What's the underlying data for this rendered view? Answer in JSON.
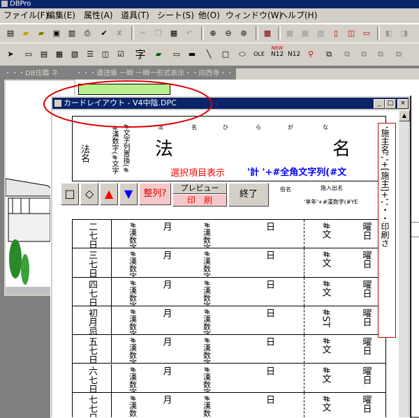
{
  "app": {
    "title": "DBPro"
  },
  "menu": [
    "ファイル(F)",
    "編集(E)",
    "属性(A)",
    "道具(T)",
    "シート(S)",
    "他(O)",
    "ウィンドウ(W)",
    "ヘルプ(H)"
  ],
  "bg_windows": {
    "db_title": "・・・DB住職 ネ",
    "form_title": "・・・運送帳 一瞬 一瞬一形式表示・・向西寺・・"
  },
  "card_window": {
    "title": "カードレイアウト - V4中陰.DPC",
    "min": "_",
    "max": "□",
    "close": "×"
  },
  "header": {
    "hint1": "#文字列置換(#",
    "hint2": "#漢数字(#文字",
    "label_hou": "法名",
    "furigana1": "法",
    "furigana2": "名",
    "furigana3": "ひ",
    "furigana4": "ら",
    "furigana5": "が",
    "furigana6": "な",
    "big1": "法",
    "big2": "名",
    "selection_red": "選択項目表示",
    "formula_blue": "'計  '+#全角文字列(#文",
    "sub_label": "俗名",
    "sub_label2": "施入出名",
    "sub_formula": "'享年'+#漢数字(#YE"
  },
  "buttons": {
    "square": "□",
    "diamond": "◇",
    "up": "▲",
    "down": "▼",
    "align": "整列?",
    "preview": "プレビュー",
    "print": "印　刷",
    "finish": "終了"
  },
  "side_panel": {
    "text": "'施主名','+[施主]+','・・印刷さ"
  },
  "rows": [
    {
      "day": "二七日",
      "cell2": "#漢数字(#日",
      "cell3": "月",
      "cell4": "#漢数字(#",
      "cell5": "日",
      "cell6": "#文",
      "cell7": "曜日"
    },
    {
      "day": "三七日",
      "cell2": "#漢数字(#日",
      "cell3": "月",
      "cell4": "#漢数字(#",
      "cell5": "日",
      "cell6": "#文",
      "cell7": "曜日"
    },
    {
      "day": "四七日",
      "cell2": "#漢数字(#日",
      "cell3": "月",
      "cell4": "#漢数字(#",
      "cell5": "日",
      "cell6": "#文",
      "cell7": "曜日"
    },
    {
      "day": "初月忌",
      "cell2": "#漢数字(#日",
      "cell3": "月",
      "cell4": "#漢数字(#I",
      "cell5": "日",
      "cell6": "#ST",
      "cell7": "曜日"
    },
    {
      "day": "五七日",
      "cell2": "#漢数字(#日",
      "cell3": "月",
      "cell4": "#漢数字(#",
      "cell5": "日",
      "cell6": "#文",
      "cell7": "曜日"
    },
    {
      "day": "六七日",
      "cell2": "#漢数字(#日",
      "cell3": "月",
      "cell4": "#漢数字(#",
      "cell5": "日",
      "cell6": "#文",
      "cell7": "曜日"
    },
    {
      "day": "七七日",
      "cell2": "#漢数字(#日",
      "cell3": "月",
      "cell4": "#漢数字(#",
      "cell5": "日",
      "cell6": "#文",
      "cell7": "曜日"
    }
  ],
  "toolbar2": {
    "ji": "字",
    "ole": "OLE",
    "new": "NEW",
    "n12": "N12"
  },
  "colors": {
    "title_active": "#0a246a",
    "highlight_red": "#ff0000",
    "formula_blue": "#0000ff",
    "pink_button": "#f4c8c8",
    "annotation_red": "#e00000"
  }
}
